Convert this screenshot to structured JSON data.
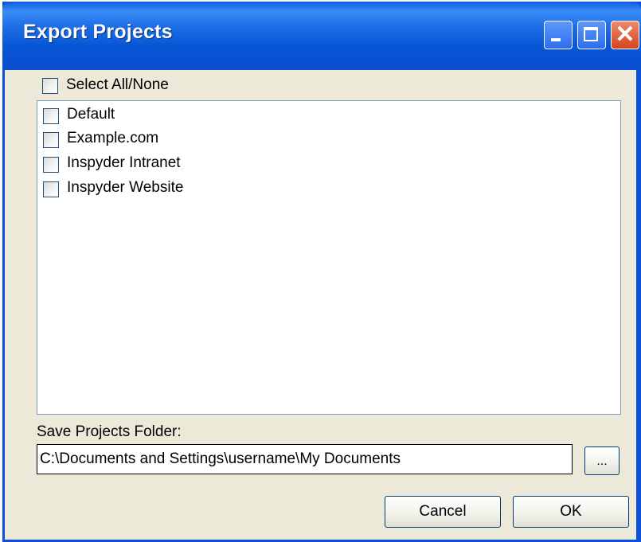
{
  "window": {
    "title": "Export Projects"
  },
  "select_all": {
    "label": "Select All/None",
    "checked": false
  },
  "projects": [
    {
      "label": "Default",
      "checked": false
    },
    {
      "label": "Example.com",
      "checked": false
    },
    {
      "label": "Inspyder Intranet",
      "checked": false
    },
    {
      "label": "Inspyder Website",
      "checked": false
    }
  ],
  "save_folder": {
    "label": "Save Projects Folder:",
    "value": "C:\\Documents and Settings\\username\\My Documents",
    "browse_label": "..."
  },
  "buttons": {
    "cancel": "Cancel",
    "ok": "OK"
  },
  "titlebar_buttons": {
    "close": "✕"
  },
  "colors": {
    "titlebar": "#0a5dd8",
    "client": "#ece9d8",
    "close": "#d4441e"
  }
}
